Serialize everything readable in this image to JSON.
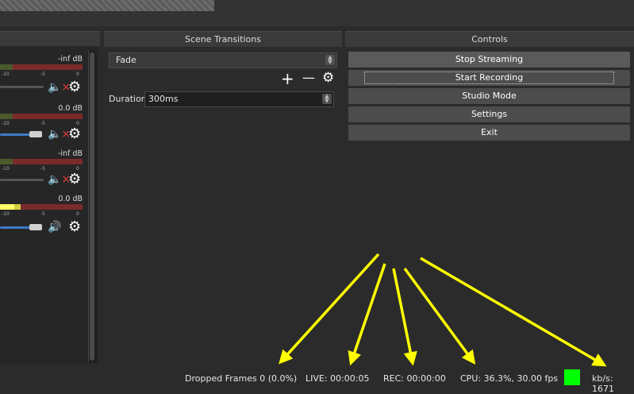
{
  "mixer": {
    "channels": [
      {
        "db": "-inf dB",
        "ticks": [
          "-10",
          "-5",
          "0"
        ],
        "muted": true,
        "level": 0.0
      },
      {
        "db": "0.0 dB",
        "ticks": [
          "-10",
          "-5",
          "0"
        ],
        "muted": true,
        "level": 0.38
      },
      {
        "db": "-inf dB",
        "ticks": [
          "-10",
          "-5",
          "0"
        ],
        "muted": true,
        "level": 0.0
      },
      {
        "db": "0.0 dB",
        "ticks": [
          "-10",
          "-5",
          "0"
        ],
        "muted": false,
        "level": 0.38
      }
    ]
  },
  "transitions": {
    "title": "Scene Transitions",
    "selected": "Fade",
    "duration_label": "Duration",
    "duration_value": "300ms",
    "add_glyph": "+",
    "remove_glyph": "—"
  },
  "controls": {
    "title": "Controls",
    "buttons": [
      "Stop Streaming",
      "Start Recording",
      "Studio Mode",
      "Settings",
      "Exit"
    ]
  },
  "status": {
    "dropped": "Dropped Frames 0 (0.0%)",
    "live": "LIVE: 00:00:05",
    "rec": "REC: 00:00:00",
    "cpu": "CPU: 36.3%, 30.00 fps",
    "kbs": "kb/s: 1671",
    "indicator_color": "#00ff00"
  },
  "colors": {
    "arrow": "#ffff00",
    "meter_green": "#4a5a2a",
    "meter_red": "#7a2a2a",
    "slider_blue": "#3d7bc8"
  }
}
